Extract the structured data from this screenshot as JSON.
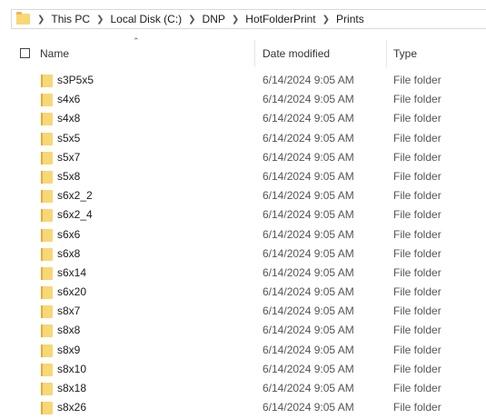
{
  "breadcrumb": {
    "segments": [
      "This PC",
      "Local Disk (C:)",
      "DNP",
      "HotFolderPrint",
      "Prints"
    ]
  },
  "columns": {
    "name": "Name",
    "date_modified": "Date modified",
    "type": "Type",
    "sort_column": "Name",
    "sort_direction": "ascending"
  },
  "items": [
    {
      "name": "s3P5x5",
      "date": "6/14/2024 9:05 AM",
      "type": "File folder"
    },
    {
      "name": "s4x6",
      "date": "6/14/2024 9:05 AM",
      "type": "File folder"
    },
    {
      "name": "s4x8",
      "date": "6/14/2024 9:05 AM",
      "type": "File folder"
    },
    {
      "name": "s5x5",
      "date": "6/14/2024 9:05 AM",
      "type": "File folder"
    },
    {
      "name": "s5x7",
      "date": "6/14/2024 9:05 AM",
      "type": "File folder"
    },
    {
      "name": "s5x8",
      "date": "6/14/2024 9:05 AM",
      "type": "File folder"
    },
    {
      "name": "s6x2_2",
      "date": "6/14/2024 9:05 AM",
      "type": "File folder"
    },
    {
      "name": "s6x2_4",
      "date": "6/14/2024 9:05 AM",
      "type": "File folder"
    },
    {
      "name": "s6x6",
      "date": "6/14/2024 9:05 AM",
      "type": "File folder"
    },
    {
      "name": "s6x8",
      "date": "6/14/2024 9:05 AM",
      "type": "File folder"
    },
    {
      "name": "s6x14",
      "date": "6/14/2024 9:05 AM",
      "type": "File folder"
    },
    {
      "name": "s6x20",
      "date": "6/14/2024 9:05 AM",
      "type": "File folder"
    },
    {
      "name": "s8x7",
      "date": "6/14/2024 9:05 AM",
      "type": "File folder"
    },
    {
      "name": "s8x8",
      "date": "6/14/2024 9:05 AM",
      "type": "File folder"
    },
    {
      "name": "s8x9",
      "date": "6/14/2024 9:05 AM",
      "type": "File folder"
    },
    {
      "name": "s8x10",
      "date": "6/14/2024 9:05 AM",
      "type": "File folder"
    },
    {
      "name": "s8x18",
      "date": "6/14/2024 9:05 AM",
      "type": "File folder"
    },
    {
      "name": "s8x26",
      "date": "6/14/2024 9:05 AM",
      "type": "File folder"
    }
  ],
  "icons": {
    "folder": "folder-icon",
    "crumb_separator": "chevron-right-icon",
    "sort": "sort-up-icon"
  },
  "colors": {
    "folder": "#f8d775",
    "folder_shade": "#e2ad3a"
  }
}
